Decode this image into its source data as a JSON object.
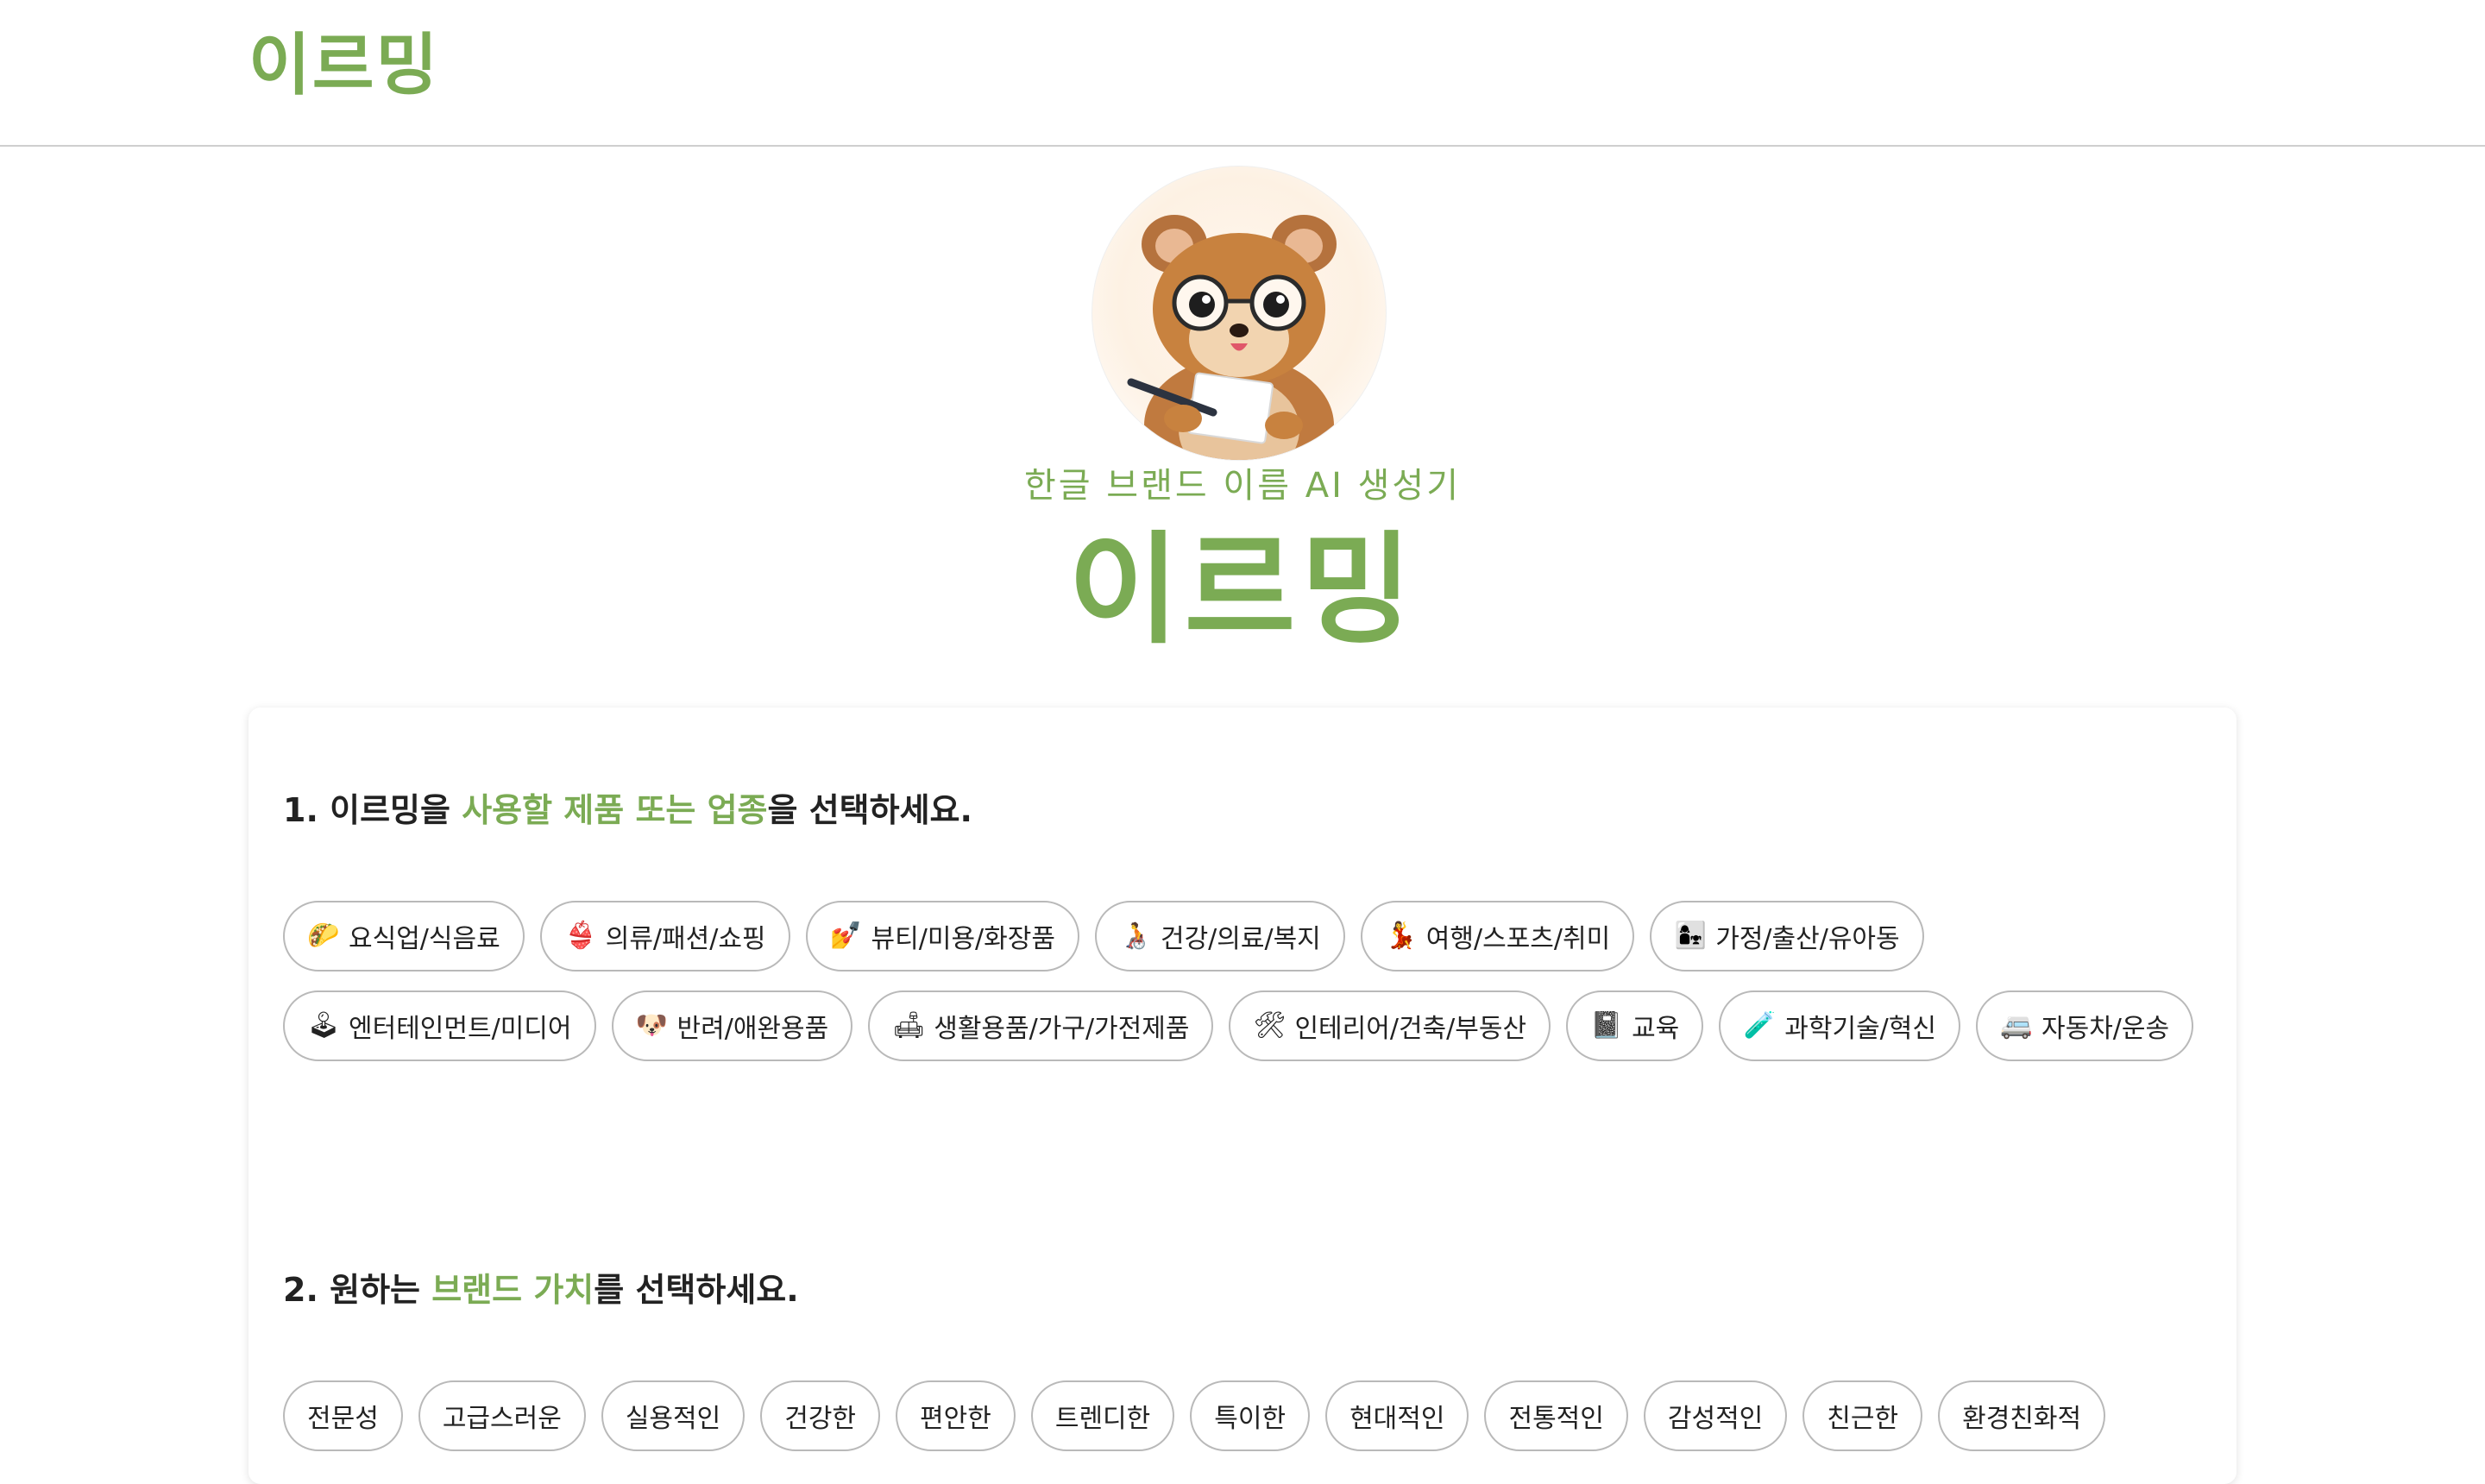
{
  "header": {
    "logo": "이르밍"
  },
  "hero": {
    "subtitle": "한글 브랜드 이름 AI 생성기",
    "title": "이르밍"
  },
  "section1": {
    "prefix": "1. 이르밍을 ",
    "highlight": "사용할 제품 또는 업종",
    "suffix": "을 선택하세요.",
    "categories": [
      {
        "icon": "taco-icon",
        "glyph": "🌮",
        "label": "요식업/식음료"
      },
      {
        "icon": "bikini-icon",
        "glyph": "👙",
        "label": "의류/패션/쇼핑"
      },
      {
        "icon": "nail-polish-icon",
        "glyph": "💅",
        "label": "뷰티/미용/화장품"
      },
      {
        "icon": "wheelchair-person-icon",
        "glyph": "🧑‍🦽",
        "label": "건강/의료/복지"
      },
      {
        "icon": "dancer-icon",
        "glyph": "💃",
        "label": "여행/스포츠/취미"
      },
      {
        "icon": "family-icon",
        "glyph": "👩‍👧",
        "label": "가정/출산/유아동"
      },
      {
        "icon": "joystick-icon",
        "glyph": "🕹",
        "label": "엔터테인먼트/미디어"
      },
      {
        "icon": "dog-icon",
        "glyph": "🐶",
        "label": "반려/애완용품"
      },
      {
        "icon": "couch-icon",
        "glyph": "🛋",
        "label": "생활용품/가구/가전제품"
      },
      {
        "icon": "tools-icon",
        "glyph": "🛠",
        "label": "인테리어/건축/부동산"
      },
      {
        "icon": "notebook-icon",
        "glyph": "📓",
        "label": "교육"
      },
      {
        "icon": "test-tube-icon",
        "glyph": "🧪",
        "label": "과학기술/혁신"
      },
      {
        "icon": "van-icon",
        "glyph": "🚐",
        "label": "자동차/운송"
      }
    ]
  },
  "section2": {
    "prefix": "2. 원하는 ",
    "highlight": "브랜드 가치",
    "suffix": "를 선택하세요.",
    "values": [
      "전문성",
      "고급스러운",
      "실용적인",
      "건강한",
      "편안한",
      "트렌디한",
      "특이한",
      "현대적인",
      "전통적인",
      "감성적인",
      "친근한",
      "환경친화적"
    ]
  },
  "colors": {
    "accent": "#7bab54",
    "chip_border": "#b9b9b9",
    "divider": "#cfcfcf"
  }
}
